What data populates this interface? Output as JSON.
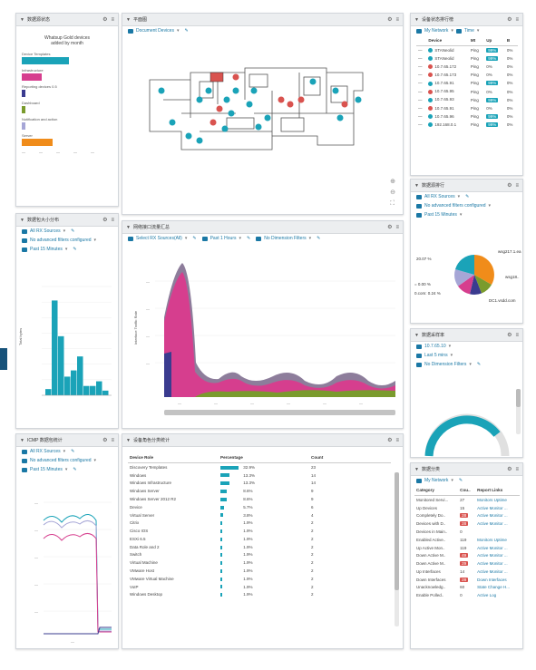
{
  "panels": {
    "top_left": {
      "title": "数据源状态"
    },
    "floorplan": {
      "title": "平面图",
      "filter": "Document Devices"
    },
    "device_list": {
      "title": "设备状态排行榜",
      "filter_network": "My Network",
      "filter_time": "Time",
      "columns": [
        "Device",
        "Mt",
        "Up",
        "B"
      ],
      "rows": [
        {
          "device": "STANeolid",
          "status_color": "#1aa3b8",
          "metric": "Ping",
          "up": "99%",
          "b": "0%",
          "badge": true
        },
        {
          "device": "STANeolid",
          "status_color": "#1aa3b8",
          "metric": "Ping",
          "up": "99%",
          "b": "0%",
          "badge": true
        },
        {
          "device": "10.7.65.172",
          "status_color": "#d9534f",
          "metric": "Ping",
          "up": "0%",
          "b": "0%",
          "badge": false
        },
        {
          "device": "10.7.65.173",
          "status_color": "#d9534f",
          "metric": "Ping",
          "up": "0%",
          "b": "0%",
          "badge": false
        },
        {
          "device": "10.7.65.91",
          "status_color": "#1aa3b8",
          "metric": "Ping",
          "up": "99%",
          "b": "0%",
          "badge": true
        },
        {
          "device": "10.7.65.95",
          "status_color": "#d9534f",
          "metric": "Ping",
          "up": "0%",
          "b": "0%",
          "badge": false
        },
        {
          "device": "10.7.65.93",
          "status_color": "#1aa3b8",
          "metric": "Ping",
          "up": "99%",
          "b": "0%",
          "badge": true
        },
        {
          "device": "10.7.65.91",
          "status_color": "#d9534f",
          "metric": "Ping",
          "up": "0%",
          "b": "0%",
          "badge": false
        },
        {
          "device": "10.7.65.96",
          "status_color": "#1aa3b8",
          "metric": "Ping",
          "up": "99%",
          "b": "0%",
          "badge": true
        },
        {
          "device": "192.168.0.1",
          "status_color": "#1aa3b8",
          "metric": "Ping",
          "up": "99%",
          "b": "0%",
          "badge": true
        }
      ]
    },
    "bar_hist": {
      "title": "数据包大小分布",
      "filter1": "All RX Sources",
      "filter2": "No advanced filters configured",
      "filter3": "Past 15 Minutes"
    },
    "traffic": {
      "title": "网络接口流量汇总",
      "filter1": "Select RX Sources(All)",
      "filter2": "Past 1 Hours",
      "filter3": "No Dimension Filters"
    },
    "pie": {
      "title": "数据源排行",
      "filter1": "All RX Sources",
      "filter2": "No advanced filters configured",
      "filter3": "Past 15 Minutes",
      "labels": [
        "20.07 %",
        "wsg217.1.ea",
        "wsg18..",
        "= 0.00 %",
        "0.com: 0.24 %",
        "DC1.vsdd.com"
      ]
    },
    "gauge": {
      "title": "数据采样率",
      "filter1": "10.7.65.10",
      "filter2": "Last 5 mins",
      "filter3": "No Dimension Filters"
    },
    "icmp": {
      "title": "ICMP 数据包统计",
      "filter1": "All RX Sources",
      "filter2": "No advanced filters configured",
      "filter3": "Past 15 Minutes"
    },
    "device_role": {
      "title": "设备角色分类统计",
      "columns": [
        "Device Role",
        "Percentage",
        "Count"
      ],
      "rows": [
        {
          "role": "Discovery Templates",
          "pct": "32.9%",
          "count": "23",
          "w": 100
        },
        {
          "role": "Windows",
          "pct": "13.3%",
          "count": "14",
          "w": 52
        },
        {
          "role": "Windows Infrastructure",
          "pct": "13.3%",
          "count": "14",
          "w": 52
        },
        {
          "role": "Windows Server",
          "pct": "8.6%",
          "count": "9",
          "w": 34
        },
        {
          "role": "Windows Server 2012 R2",
          "pct": "8.6%",
          "count": "9",
          "w": 34
        },
        {
          "role": "Device",
          "pct": "5.7%",
          "count": "6",
          "w": 22
        },
        {
          "role": "Virtual Server",
          "pct": "3.8%",
          "count": "4",
          "w": 15
        },
        {
          "role": "Citrix",
          "pct": "1.9%",
          "count": "2",
          "w": 8
        },
        {
          "role": "Cisco IOS",
          "pct": "1.9%",
          "count": "2",
          "w": 8
        },
        {
          "role": "ESXi 6.5",
          "pct": "1.9%",
          "count": "2",
          "w": 8
        },
        {
          "role": "Data Role and 2",
          "pct": "1.9%",
          "count": "2",
          "w": 8
        },
        {
          "role": "Switch",
          "pct": "1.9%",
          "count": "2",
          "w": 8
        },
        {
          "role": "Virtual Machine",
          "pct": "1.9%",
          "count": "2",
          "w": 8
        },
        {
          "role": "VMware Host",
          "pct": "1.9%",
          "count": "2",
          "w": 8
        },
        {
          "role": "VMware Virtual Machine",
          "pct": "1.9%",
          "count": "2",
          "w": 8
        },
        {
          "role": "VoIP",
          "pct": "1.9%",
          "count": "2",
          "w": 8
        },
        {
          "role": "Windows Desktop",
          "pct": "1.9%",
          "count": "2",
          "w": 8
        }
      ]
    },
    "category": {
      "title": "数据分类",
      "filter1": "My Network",
      "columns": [
        "Category",
        "Cou..",
        "Report Links"
      ],
      "rows": [
        {
          "cat": "Monitored Servi...",
          "count": "27",
          "link": "Monitors Uptime",
          "red": false
        },
        {
          "cat": "Up Devices",
          "count": "15",
          "link": "Active Monitor ...",
          "red": false
        },
        {
          "cat": "Completely Do..",
          "count": "28",
          "link": "Active Monitor ...",
          "red": true
        },
        {
          "cat": "Devices with D..",
          "count": "28",
          "link": "Active Monitor ...",
          "red": true
        },
        {
          "cat": "Devices in Main..",
          "count": "0",
          "link": "",
          "red": false
        },
        {
          "cat": "Enabled Active..",
          "count": "119",
          "link": "Monitors Uptime",
          "red": false
        },
        {
          "cat": "Up Active Mon..",
          "count": "119",
          "link": "Active Monitor ...",
          "red": false
        },
        {
          "cat": "Down Active M..",
          "count": "49",
          "link": "Active Monitor ...",
          "red": true
        },
        {
          "cat": "Down Active M..",
          "count": "29",
          "link": "Active Monitor ...",
          "red": true
        },
        {
          "cat": "Up Interfaces",
          "count": "14",
          "link": "Active Monitor ...",
          "red": false
        },
        {
          "cat": "Down Interfaces",
          "count": "28",
          "link": "Down Interfaces",
          "red": true
        },
        {
          "cat": "Unacknowledg..",
          "count": "60",
          "link": "State Change H...",
          "red": false
        },
        {
          "cat": "Enable Polled..",
          "count": "0",
          "link": "Active Log",
          "red": false
        }
      ]
    }
  },
  "hbar_chart": {
    "title": "Whatsup Gold devices added by month",
    "categories": [
      "Device Templates",
      "Infrastructure",
      "Reporting devices 0.5 ",
      "Dashboard",
      "Notification and action ",
      "Server"
    ],
    "values": [
      95,
      40,
      8,
      8,
      8,
      62
    ],
    "colors": [
      "#1aa3b8",
      "#d63e8e",
      "#3a3b8f",
      "#7a9b2d",
      "#a6a6d6",
      "#f08c1a"
    ]
  },
  "chart_data": [
    {
      "type": "bar",
      "title": "",
      "categories": [
        "1",
        "2",
        "3",
        "4",
        "5",
        "6",
        "7",
        "8",
        "9",
        "10"
      ],
      "values": [
        0.4,
        6.1,
        3.8,
        1.2,
        1.6,
        2.5,
        0.6,
        0.6,
        0.9,
        0.3
      ],
      "ylabel": "Total bytes",
      "ylim": [
        0,
        7
      ]
    },
    {
      "type": "area",
      "title": "",
      "ylabel": "Interface Traffic Rate",
      "series": [
        {
          "values": [
            0,
            100,
            20,
            5,
            4,
            6,
            5,
            8,
            4,
            6,
            4,
            3
          ]
        }
      ]
    }
  ]
}
